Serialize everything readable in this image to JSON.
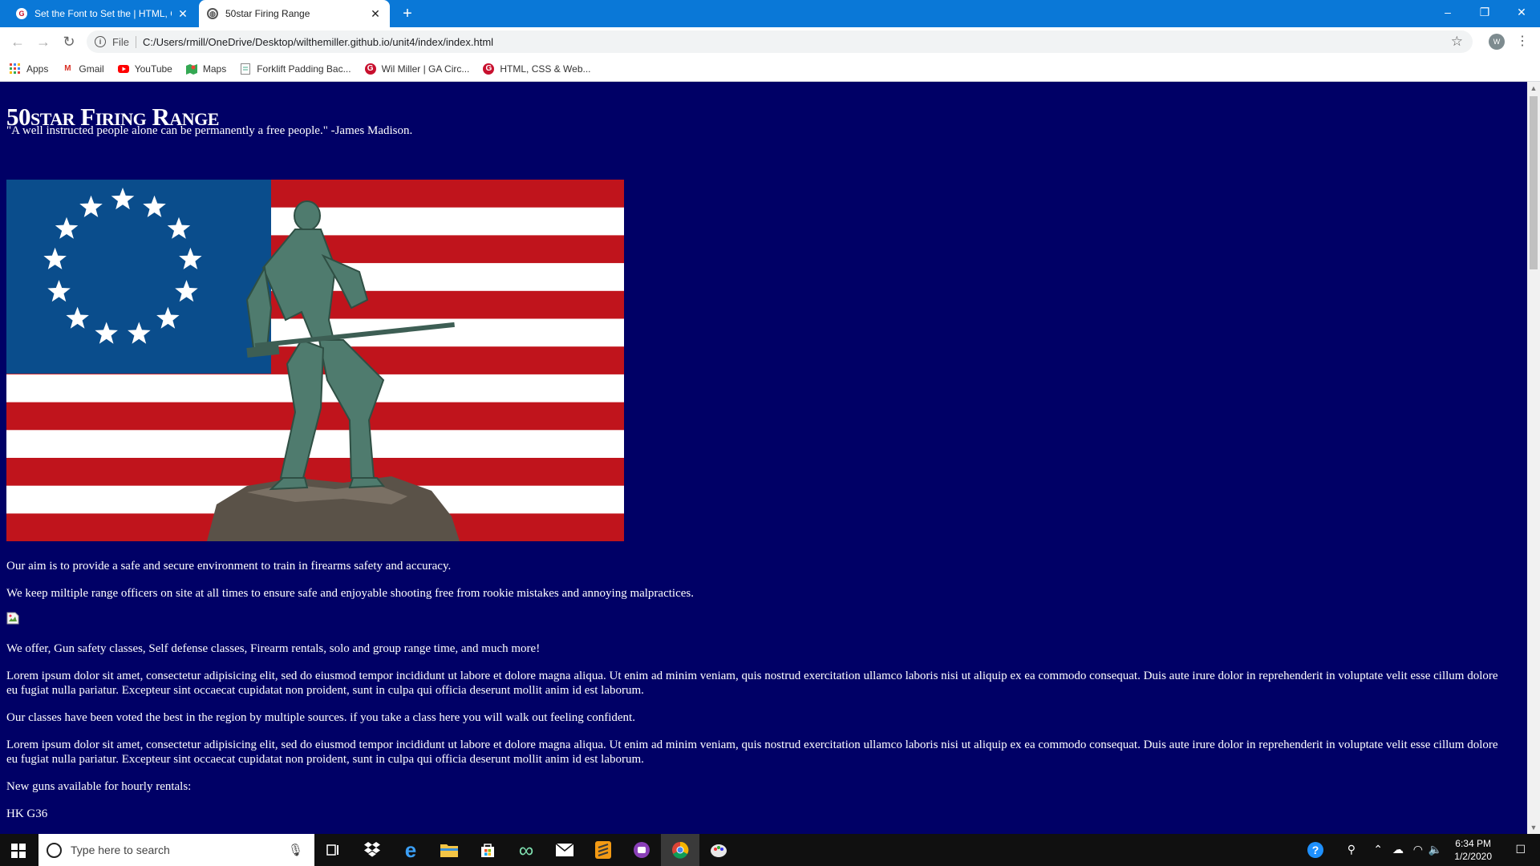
{
  "browser": {
    "tabs": [
      {
        "title": "Set the Font to Set the | HTML, C",
        "favicon": "ga-icon",
        "active": false
      },
      {
        "title": "50star Firing Range",
        "favicon": "globe-icon",
        "active": true
      }
    ],
    "new_tab_symbol": "+",
    "window_controls": {
      "minimize": "–",
      "restore": "❐",
      "close": "✕"
    },
    "nav": {
      "back": "←",
      "forward": "→",
      "reload": "↻"
    },
    "omnibox": {
      "chip": "File",
      "url": "C:/Users/rmill/OneDrive/Desktop/wilthemiller.github.io/unit4/index/index.html"
    },
    "profile_initial": "W",
    "bookmarks": [
      {
        "label": "Apps",
        "icon": "apps-grid-icon"
      },
      {
        "label": "Gmail",
        "icon": "gmail-icon"
      },
      {
        "label": "YouTube",
        "icon": "youtube-icon"
      },
      {
        "label": "Maps",
        "icon": "maps-icon"
      },
      {
        "label": "Forklift Padding Bac...",
        "icon": "document-icon"
      },
      {
        "label": "Wil Miller | GA Circ...",
        "icon": "ga-icon"
      },
      {
        "label": "HTML, CSS & Web...",
        "icon": "ga-icon"
      }
    ]
  },
  "page": {
    "title": "50star Firing Range",
    "quote": "\"A well instructed people alone can be permanently a free people.\" -James Madison.",
    "hero_image": "flag-minuteman-image",
    "paragraphs": {
      "aim": "Our aim is to provide a safe and secure environment to train in firearms safety and accuracy.",
      "officers": "We keep miltiple range officers on site at all times to ensure safe and enjoyable shooting free from rookie mistakes and annoying malpractices.",
      "offer": "We offer, Gun safety classes, Self defense classes, Firearm rentals, solo and group range time, and much more!",
      "lorem1": "Lorem ipsum dolor sit amet, consectetur adipisicing elit, sed do eiusmod tempor incididunt ut labore et dolore magna aliqua. Ut enim ad minim veniam, quis nostrud exercitation ullamco laboris nisi ut aliquip ex ea commodo consequat. Duis aute irure dolor in reprehenderit in voluptate velit esse cillum dolore eu fugiat nulla pariatur. Excepteur sint occaecat cupidatat non proident, sunt in culpa qui officia deserunt mollit anim id est laborum.",
      "classes": "Our classes have been voted the best in the region by multiple sources. if you take a class here you will walk out feeling confident.",
      "lorem2": "Lorem ipsum dolor sit amet, consectetur adipisicing elit, sed do eiusmod tempor incididunt ut labore et dolore magna aliqua. Ut enim ad minim veniam, quis nostrud exercitation ullamco laboris nisi ut aliquip ex ea commodo consequat. Duis aute irure dolor in reprehenderit in voluptate velit esse cillum dolore eu fugiat nulla pariatur. Excepteur sint occaecat cupidatat non proident, sunt in culpa qui officia deserunt mollit anim id est laborum.",
      "new_guns": "New guns available for hourly rentals:",
      "gun1": "HK G36"
    },
    "colors": {
      "background": "#000066",
      "text": "#ffffff",
      "flag_red": "#c0141c",
      "flag_blue": "#0a4d8c"
    }
  },
  "taskbar": {
    "search_placeholder": "Type here to search",
    "apps": [
      "task-view-icon",
      "dropbox-icon",
      "edge-icon",
      "file-explorer-icon",
      "store-icon",
      "infinity-icon",
      "mail-icon",
      "sublime-icon",
      "purple-app-icon",
      "chrome-icon",
      "paint-icon"
    ],
    "clock_time": "6:34 PM",
    "clock_date": "1/2/2020"
  }
}
